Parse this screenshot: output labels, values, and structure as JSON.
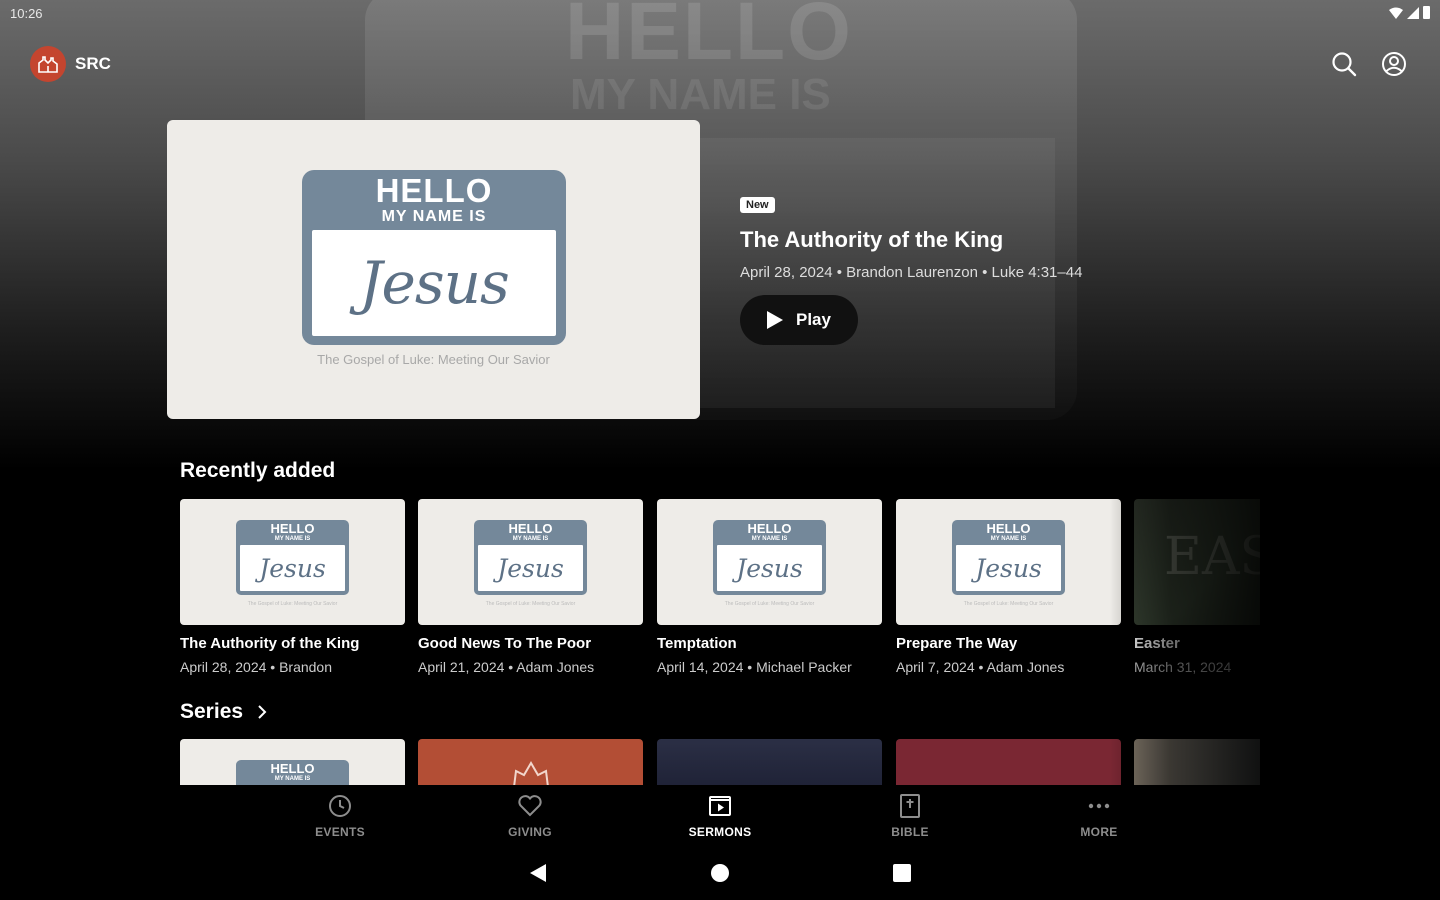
{
  "status": {
    "time": "10:26"
  },
  "app": {
    "name": "SRC"
  },
  "hero_background": {
    "line1": "HELLO",
    "line2": "MY NAME IS"
  },
  "hero": {
    "artwork": {
      "hello": "HELLO",
      "my_name_is": "MY NAME IS",
      "name": "Jesus",
      "subtitle": "The Gospel of Luke: Meeting Our Savior"
    },
    "badge": "New",
    "title": "The Authority of the King",
    "meta": "April 28, 2024 • Brandon Laurenzon • Luke 4:31–44",
    "play_label": "Play"
  },
  "recently_added": {
    "title": "Recently added",
    "items": [
      {
        "title": "The Authority of the King",
        "meta": "April 28, 2024 • Brandon"
      },
      {
        "title": "Good News To The Poor",
        "meta": "April 21, 2024 • Adam Jones"
      },
      {
        "title": "Temptation",
        "meta": "April 14, 2024 • Michael Packer"
      },
      {
        "title": "Prepare The Way",
        "meta": "April 7, 2024 • Adam Jones"
      },
      {
        "title": "Easter",
        "meta": "March 31, 2024",
        "art_text": "EAS"
      }
    ],
    "thumb_art": {
      "hello": "HELLO",
      "my_name_is": "MY NAME IS",
      "name": "Jesus",
      "subtitle": "The Gospel of Luke: Meeting Our Savior"
    }
  },
  "series": {
    "title": "Series",
    "first_art": {
      "hello": "HELLO",
      "my_name_is": "MY NAME IS"
    }
  },
  "bottom_nav": {
    "items": [
      {
        "label": "EVENTS",
        "icon": "clock-icon"
      },
      {
        "label": "GIVING",
        "icon": "heart-icon"
      },
      {
        "label": "SERMONS",
        "icon": "play-square-icon",
        "active": true
      },
      {
        "label": "BIBLE",
        "icon": "book-icon"
      },
      {
        "label": "MORE",
        "icon": "more-dots-icon"
      }
    ]
  },
  "colors": {
    "brand": "#c4452f",
    "tag": "#74889a",
    "card": "#eeece8"
  }
}
